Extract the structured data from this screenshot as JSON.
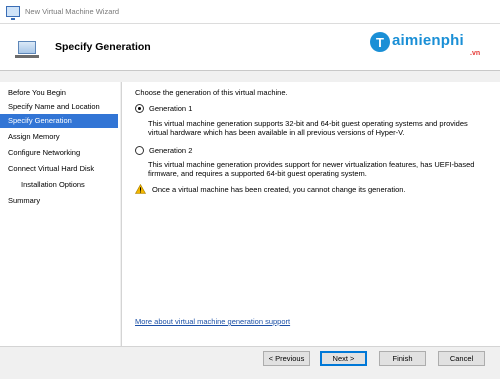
{
  "window": {
    "title": "New Virtual Machine Wizard",
    "icon": "virtual-machine-icon"
  },
  "header": {
    "title": "Specify Generation",
    "icon": "monitor-icon"
  },
  "watermark": {
    "mark": "T",
    "name": "aimienphi",
    "suffix": ".vn"
  },
  "sidebar": {
    "items": [
      {
        "label": "Before You Begin",
        "active": false
      },
      {
        "label": "Specify Name and Location",
        "active": false
      },
      {
        "label": "Specify Generation",
        "active": true
      },
      {
        "label": "Assign Memory",
        "active": false
      },
      {
        "label": "Configure Networking",
        "active": false
      },
      {
        "label": "Connect Virtual Hard Disk",
        "active": false
      },
      {
        "label": "Installation Options",
        "active": false,
        "indent": true
      },
      {
        "label": "Summary",
        "active": false
      }
    ]
  },
  "main": {
    "prompt": "Choose the generation of this virtual machine.",
    "options": [
      {
        "label": "Generation 1",
        "selected": true,
        "description": "This virtual machine generation supports 32-bit and 64-bit guest operating systems and provides virtual hardware which has been available in all previous versions of Hyper-V."
      },
      {
        "label": "Generation 2",
        "selected": false,
        "description": "This virtual machine generation provides support for newer virtualization features, has UEFI-based firmware, and requires a supported 64-bit guest operating system."
      }
    ],
    "warning": "Once a virtual machine has been created, you cannot change its generation.",
    "link": "More about virtual machine generation support"
  },
  "buttons": {
    "previous": "< Previous",
    "next": "Next >",
    "finish": "Finish",
    "cancel": "Cancel"
  },
  "colors": {
    "accent": "#3275d5",
    "link": "#1a4fa6",
    "warning": "#f2b600"
  }
}
